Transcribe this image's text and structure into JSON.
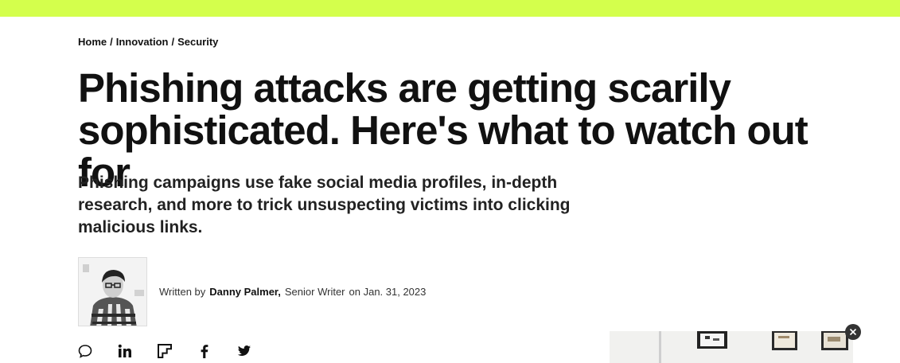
{
  "breadcrumb": {
    "home": "Home",
    "sep1": "/",
    "innovation": "Innovation",
    "sep2": "/",
    "security": "Security"
  },
  "article": {
    "headline": "Phishing attacks are getting scarily sophisticated. Here's what to watch out for",
    "dek": "Phishing campaigns use fake social media profiles, in-depth research, and more to trick unsuspecting victims into clicking malicious links."
  },
  "byline": {
    "written_by": "Written by",
    "author_name": "Danny Palmer,",
    "author_title": "Senior Writer",
    "on_date": "on Jan. 31, 2023"
  },
  "share_icons": [
    "comment-icon",
    "linkedin-icon",
    "flipboard-icon",
    "facebook-icon",
    "twitter-icon"
  ],
  "video_player": {
    "close_icon": "close-icon"
  },
  "colors": {
    "topbar": "#d4ff4c",
    "text": "#111111"
  }
}
